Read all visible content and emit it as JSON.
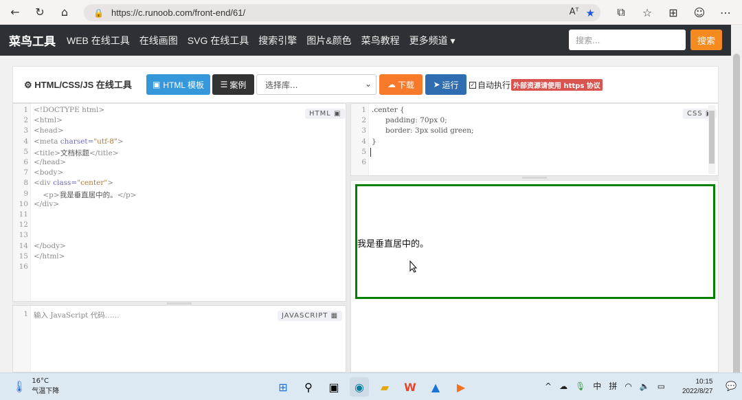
{
  "browser": {
    "url": "https://c.runoob.com/front-end/61/",
    "reader_label": "Aᵀ"
  },
  "site": {
    "brand": "菜鸟工具",
    "nav": [
      "WEB 在线工具",
      "在线画图",
      "SVG 在线工具",
      "搜索引擎",
      "图片&颜色",
      "菜鸟教程",
      "更多频道 ▾"
    ],
    "search_placeholder": "搜索...",
    "search_button": "搜索"
  },
  "toolbar": {
    "title": "HTML/CSS/JS 在线工具",
    "html_template": "HTML 模板",
    "cases": "案例",
    "select_library": "选择库...",
    "download": "下载",
    "run": "运行",
    "auto_run": "自动执行",
    "warning": "外部资源请使用 https 协议"
  },
  "html_editor": {
    "badge": "HTML",
    "line_numbers": [
      "1",
      "2",
      "3",
      "4",
      "5",
      "6",
      "7",
      "8",
      "9",
      "10",
      "11",
      "12",
      "13",
      "14",
      "15",
      "16"
    ]
  },
  "css_editor": {
    "badge": "CSS",
    "line_numbers": [
      "1",
      "2",
      "3",
      "4",
      "5",
      "6"
    ],
    "lines": [
      ".center {",
      "      padding: 70px 0;",
      "      border: 3px solid green;",
      "}",
      "",
      ""
    ]
  },
  "js_editor": {
    "badge": "JAVASCRIPT",
    "line_numbers": [
      "1"
    ],
    "placeholder": "输入 JavaScript 代码……"
  },
  "preview": {
    "text": "我是垂直居中的。"
  },
  "taskbar": {
    "temperature": "16°C",
    "weather": "气温下降",
    "time": "10:15",
    "date": "2022/8/27",
    "ime1": "中",
    "ime2": "拼"
  }
}
